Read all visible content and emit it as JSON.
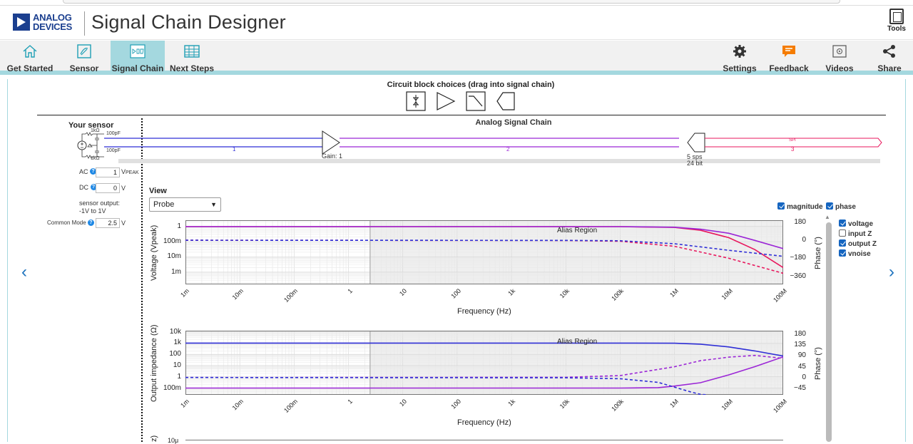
{
  "header": {
    "brand_line1": "ANALOG",
    "brand_line2": "DEVICES",
    "app_title": "Signal Chain Designer",
    "tools_label": "Tools"
  },
  "nav": {
    "left": [
      {
        "label": "Get Started",
        "icon": "home-icon"
      },
      {
        "label": "Sensor",
        "icon": "sensor-icon"
      },
      {
        "label": "Signal Chain",
        "icon": "signal-chain-icon",
        "active": true
      },
      {
        "label": "Next Steps",
        "icon": "table-icon"
      }
    ],
    "right": [
      {
        "label": "Settings",
        "icon": "gear-icon"
      },
      {
        "label": "Feedback",
        "icon": "feedback-icon"
      },
      {
        "label": "Videos",
        "icon": "video-icon"
      },
      {
        "label": "Share",
        "icon": "share-icon"
      }
    ]
  },
  "colors": {
    "accent": "#a4d8df",
    "link": "#1e73be",
    "check": "#1565c0",
    "series_pink": "#e8175d",
    "series_purple": "#9b26d6",
    "series_blue": "#2f2fd6"
  },
  "circuit": {
    "choices_title": "Circuit block choices (drag into signal chain)",
    "sensor_title": "Your sensor",
    "chain_title": "Analog Signal Chain",
    "resistor1": "1kΩ",
    "resistor2": "1kΩ",
    "cap1": "100pF",
    "cap2": "100pF",
    "segment1": "1",
    "segment2": "2",
    "segment3": "3",
    "gain": "Gain: 1",
    "adc_rate": "5 sps",
    "adc_bits": "24 bit",
    "bus": "SPI"
  },
  "sensor": {
    "ac_label": "AC",
    "ac_value": "1",
    "ac_unit_main": "V",
    "ac_unit_sub": "PEAK",
    "dc_label": "DC",
    "dc_value": "0",
    "dc_unit": "V",
    "output_label": "sensor output:",
    "output_range": "-1V to 1V",
    "cm_label": "Common Mode",
    "cm_value": "2.5",
    "cm_unit": "V"
  },
  "view": {
    "label": "View",
    "selected": "Probe",
    "magnitude": "magnitude",
    "phase": "phase",
    "toggles": [
      {
        "label": "voltage",
        "checked": true
      },
      {
        "label": "input Z",
        "checked": false
      },
      {
        "label": "output Z",
        "checked": true
      },
      {
        "label": "vnoise",
        "checked": true
      }
    ]
  },
  "chart_data": [
    {
      "type": "line",
      "xlabel": "Frequency (Hz)",
      "ylabel": "Voltage (Vpeak)",
      "y2label": "Phase (°)",
      "annotation": "Alias Region",
      "x_ticks": [
        "1m",
        "10m",
        "100m",
        "1",
        "10",
        "100",
        "1k",
        "10k",
        "100k",
        "1M",
        "10M",
        "100M"
      ],
      "y_ticks": [
        "100m",
        "10m",
        "1m"
      ],
      "y2_ticks": [
        "180",
        "0",
        "−180",
        "−360"
      ],
      "xlim": [
        0.001,
        100000000
      ],
      "ylim_log10": [
        -3.8,
        0.4
      ],
      "y2lim": [
        -440,
        200
      ],
      "alias_start_hz": 2.5,
      "series": [
        {
          "color": "#e8175d",
          "dash": false,
          "axis": "y",
          "x": [
            0.001,
            100000,
            1000000,
            3000000,
            10000000,
            30000000,
            100000000
          ],
          "y": [
            0.95,
            0.95,
            0.85,
            0.55,
            0.18,
            0.03,
            0.002
          ]
        },
        {
          "color": "#9b26d6",
          "dash": false,
          "axis": "y",
          "x": [
            0.001,
            100000,
            1000000,
            3000000,
            10000000,
            30000000,
            100000000
          ],
          "y": [
            0.95,
            0.95,
            0.88,
            0.65,
            0.35,
            0.12,
            0.035
          ]
        },
        {
          "color": "#e8175d",
          "dash": true,
          "axis": "y2",
          "x": [
            0.001,
            10000,
            100000,
            1000000,
            10000000,
            100000000
          ],
          "y": [
            0,
            -2,
            -10,
            -60,
            -180,
            -330
          ]
        },
        {
          "color": "#2f2fd6",
          "dash": true,
          "axis": "y2",
          "x": [
            0.001,
            10000,
            100000,
            1000000,
            10000000,
            100000000
          ],
          "y": [
            0,
            -1,
            -5,
            -35,
            -100,
            -160
          ]
        }
      ]
    },
    {
      "type": "line",
      "xlabel": "Frequency (Hz)",
      "ylabel": "Output impedance (Ω)",
      "y2label": "Phase (°)",
      "annotation": "Alias Region",
      "x_ticks": [
        "1m",
        "10m",
        "100m",
        "1",
        "10",
        "100",
        "1k",
        "10k",
        "100k",
        "1M",
        "10M",
        "100M"
      ],
      "y_ticks": [
        "10k",
        "1k",
        "100",
        "10",
        "1",
        "100m"
      ],
      "y2_ticks": [
        "180",
        "135",
        "90",
        "45",
        "0",
        "−45"
      ],
      "xlim": [
        0.001,
        100000000
      ],
      "ylim_log10": [
        -1.6,
        4.1
      ],
      "y2lim": [
        -72,
        195
      ],
      "alias_start_hz": 2.5,
      "series": [
        {
          "color": "#2f2fd6",
          "dash": false,
          "axis": "y",
          "x": [
            0.001,
            100000,
            1000000,
            3000000,
            10000000,
            30000000,
            100000000
          ],
          "y": [
            1000,
            1000,
            970,
            800,
            450,
            200,
            70
          ]
        },
        {
          "color": "#9b26d6",
          "dash": false,
          "axis": "y",
          "x": [
            0.001,
            100000,
            500000,
            1000000,
            3000000,
            10000000,
            30000000,
            100000000
          ],
          "y": [
            0.1,
            0.1,
            0.11,
            0.15,
            0.3,
            1.5,
            8,
            60
          ]
        },
        {
          "color": "#9b26d6",
          "dash": true,
          "axis": "y2",
          "x": [
            0.001,
            10000,
            100000,
            1000000,
            3000000,
            10000000,
            30000000,
            100000000
          ],
          "y": [
            0,
            1,
            8,
            45,
            70,
            85,
            92,
            80
          ]
        },
        {
          "color": "#2f2fd6",
          "dash": true,
          "axis": "y2",
          "x": [
            0.001,
            10000,
            100000,
            500000,
            1000000,
            2000000,
            3000000,
            4000000
          ],
          "y": [
            0,
            -1,
            -5,
            -20,
            -40,
            -60,
            -70,
            -72
          ]
        }
      ]
    }
  ],
  "chart3_partial": {
    "y_tick": "10μ",
    "ylabel_fragment": "z)"
  }
}
